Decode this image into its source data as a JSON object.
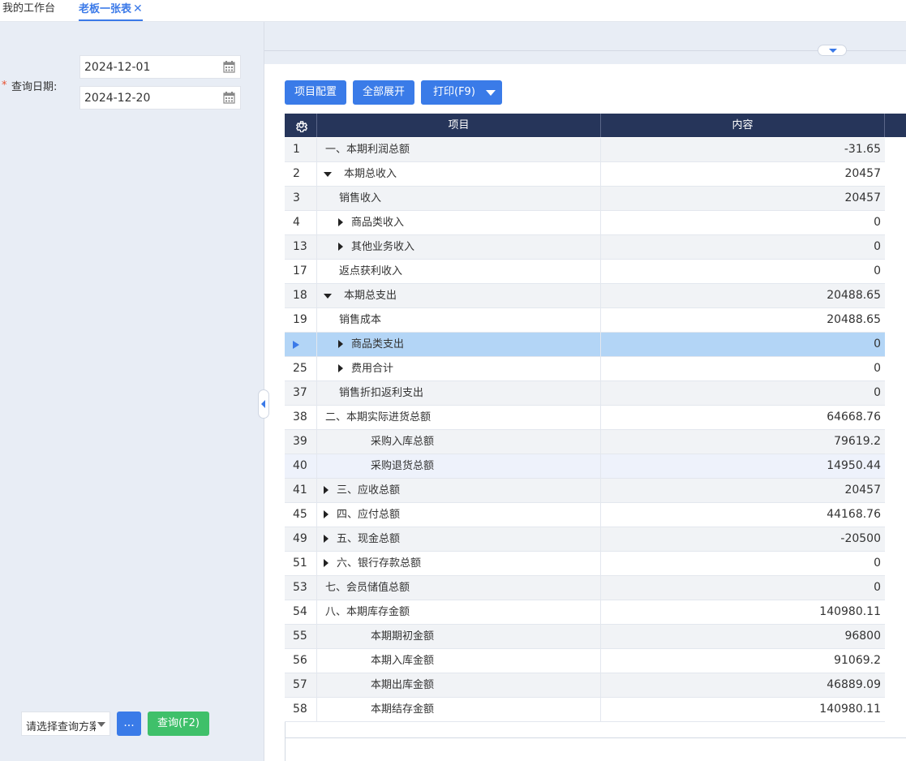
{
  "tabs": {
    "workbench": "我的工作台",
    "report": "老板一张表",
    "close_glyph": "✕"
  },
  "query": {
    "required_mark": "*",
    "date_label": "查询日期:",
    "start_date": "2024-12-01",
    "end_date": "2024-12-20",
    "scheme_placeholder": "请选择查询方案",
    "more_label": "...",
    "query_label": "查询(F2)"
  },
  "toolbar": {
    "config_label": "项目配置",
    "expand_all_label": "全部展开",
    "print_label": "打印(F9)"
  },
  "grid": {
    "columns": [
      "项目",
      "内容"
    ],
    "rows": [
      {
        "no": "1",
        "item": "一、本期利润总额",
        "value": "-31.65",
        "indent": 0,
        "toggle": "none",
        "selected": false
      },
      {
        "no": "2",
        "item": "本期总收入",
        "value": "20457",
        "indent": 0,
        "toggle": "down",
        "selected": false
      },
      {
        "no": "3",
        "item": "销售收入",
        "value": "20457",
        "indent": 1,
        "toggle": "none",
        "selected": false
      },
      {
        "no": "4",
        "item": "商品类收入",
        "value": "0",
        "indent": 1,
        "toggle": "right",
        "selected": false
      },
      {
        "no": "13",
        "item": "其他业务收入",
        "value": "0",
        "indent": 1,
        "toggle": "right",
        "selected": false
      },
      {
        "no": "17",
        "item": "返点获利收入",
        "value": "0",
        "indent": 1,
        "toggle": "none",
        "selected": false
      },
      {
        "no": "18",
        "item": "本期总支出",
        "value": "20488.65",
        "indent": 0,
        "toggle": "down",
        "selected": false
      },
      {
        "no": "19",
        "item": "销售成本",
        "value": "20488.65",
        "indent": 1,
        "toggle": "none",
        "selected": false
      },
      {
        "no": "",
        "item": "商品类支出",
        "value": "0",
        "indent": 1,
        "toggle": "right",
        "selected": true
      },
      {
        "no": "25",
        "item": "费用合计",
        "value": "0",
        "indent": 1,
        "toggle": "right",
        "selected": false
      },
      {
        "no": "37",
        "item": "销售折扣返利支出",
        "value": "0",
        "indent": 1,
        "toggle": "none",
        "selected": false
      },
      {
        "no": "38",
        "item": "二、本期实际进货总额",
        "value": "64668.76",
        "indent": 0,
        "toggle": "none",
        "selected": false
      },
      {
        "no": "39",
        "item": "采购入库总额",
        "value": "79619.2",
        "indent": 2,
        "toggle": "none",
        "selected": false
      },
      {
        "no": "40",
        "item": "采购退货总额",
        "value": "14950.44",
        "indent": 2,
        "toggle": "none",
        "selected": false,
        "highlight": true
      },
      {
        "no": "41",
        "item": "三、应收总额",
        "value": "20457",
        "indent": 0,
        "toggle": "right",
        "selected": false
      },
      {
        "no": "45",
        "item": "四、应付总额",
        "value": "44168.76",
        "indent": 0,
        "toggle": "right",
        "selected": false
      },
      {
        "no": "49",
        "item": "五、现金总额",
        "value": "-20500",
        "indent": 0,
        "toggle": "right",
        "selected": false
      },
      {
        "no": "51",
        "item": "六、银行存款总额",
        "value": "0",
        "indent": 0,
        "toggle": "right",
        "selected": false
      },
      {
        "no": "53",
        "item": "七、会员储值总额",
        "value": "0",
        "indent": 0,
        "toggle": "none",
        "selected": false
      },
      {
        "no": "54",
        "item": "八、本期库存金额",
        "value": "140980.11",
        "indent": 0,
        "toggle": "none",
        "selected": false
      },
      {
        "no": "55",
        "item": "本期期初金额",
        "value": "96800",
        "indent": 2,
        "toggle": "none",
        "selected": false
      },
      {
        "no": "56",
        "item": "本期入库金额",
        "value": "91069.2",
        "indent": 2,
        "toggle": "none",
        "selected": false
      },
      {
        "no": "57",
        "item": "本期出库金额",
        "value": "46889.09",
        "indent": 2,
        "toggle": "none",
        "selected": false
      },
      {
        "no": "58",
        "item": "本期结存金额",
        "value": "140980.11",
        "indent": 2,
        "toggle": "none",
        "selected": false
      }
    ]
  },
  "colors": {
    "primary": "#3a7be8",
    "success": "#3fc06a",
    "header_bg": "#26355a",
    "selected_row": "#b3d5f6",
    "panel_bg": "#e8edf5",
    "required": "#e8502f"
  },
  "icons": {
    "calendar": "calendar-icon",
    "gear": "gear-icon",
    "collapse": "collapse-left-icon",
    "expand": "expand-down-icon"
  }
}
